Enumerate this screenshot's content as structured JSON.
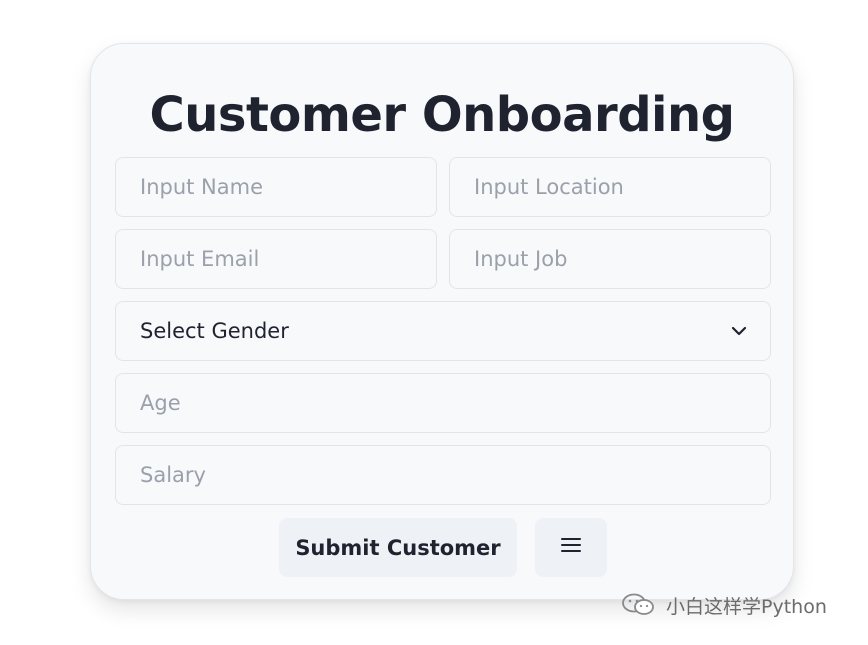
{
  "form": {
    "title": "Customer Onboarding",
    "name_placeholder": "Input Name",
    "location_placeholder": "Input Location",
    "email_placeholder": "Input Email",
    "job_placeholder": "Input Job",
    "gender_selected": "Select Gender",
    "age_placeholder": "Age",
    "salary_placeholder": "Salary",
    "submit_label": "Submit Customer"
  },
  "icons": {
    "gender_dropdown": "chevron-down-icon",
    "menu": "hamburger-menu-icon",
    "watermark": "wechat-icon"
  },
  "watermark": {
    "text": "小白这样学Python"
  },
  "colors": {
    "card_background": "#f8f9fb",
    "title_text": "#1f2330",
    "placeholder_text": "#9aa1ab",
    "button_background": "#eef1f5"
  }
}
